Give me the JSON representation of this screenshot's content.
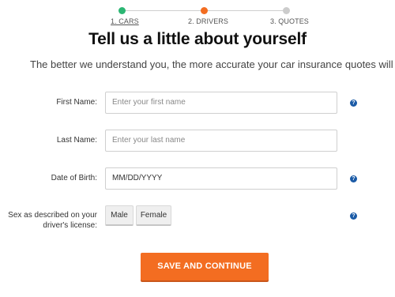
{
  "stepper": {
    "steps": [
      {
        "label": "1. CARS",
        "color": "#2bb673",
        "state": "active"
      },
      {
        "label": "2. DRIVERS",
        "color": "#f36d21",
        "state": "current"
      },
      {
        "label": "3. QUOTES",
        "color": "#cccccc",
        "state": "upcoming"
      }
    ]
  },
  "header": {
    "title": "Tell us a little about yourself",
    "subtitle": "The better we understand you, the more accurate your car insurance quotes will be"
  },
  "form": {
    "first_name": {
      "label": "First Name:",
      "placeholder": "Enter your  first name"
    },
    "last_name": {
      "label": "Last Name:",
      "placeholder": "Enter your  last name"
    },
    "dob": {
      "label": "Date of Birth:",
      "value": "MM/DD/YYYY"
    },
    "sex": {
      "label_line1": "Sex as described on your",
      "label_line2": "driver's license:",
      "options": [
        "Male",
        "Female"
      ]
    },
    "help_icon": "?"
  },
  "actions": {
    "save_label": "SAVE AND CONTINUE"
  },
  "colors": {
    "accent": "#f36d21",
    "help": "#1a5aa6"
  }
}
